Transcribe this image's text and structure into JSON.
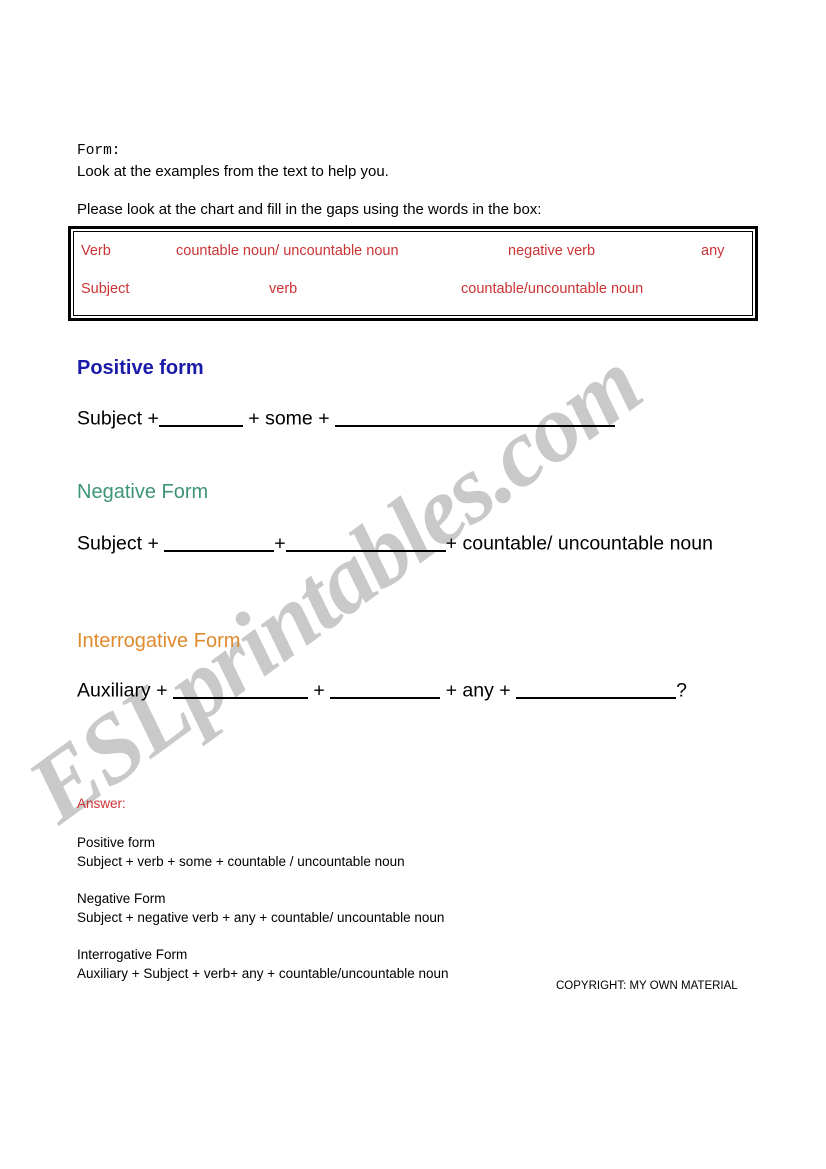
{
  "watermark": {
    "text": "ESLprintables.com",
    "color": "#c9c9c9"
  },
  "header": {
    "form_label": "Form:",
    "instruction_1": "Look at the examples from the text  to help you.",
    "instruction_2": "Please look at the chart and fill in the gaps using the words in the box:"
  },
  "word_box": {
    "color": "#cc3333",
    "row1": [
      "Verb",
      "countable noun/ uncountable noun",
      "negative verb",
      "any"
    ],
    "row2": [
      "Subject",
      "verb",
      "countable/uncountable noun"
    ]
  },
  "sections": {
    "positive": {
      "heading": "Positive form",
      "color": "#1a1aa8",
      "prefix": "Subject +",
      "middle": "+ some +"
    },
    "negative": {
      "heading": "Negative Form",
      "color": "#3e9478",
      "prefix": "Subject +",
      "plus": "+",
      "suffix": "+ countable/ uncountable",
      "wrap": "noun"
    },
    "interrogative": {
      "heading": "Interrogative Form",
      "color": "#e08a2e",
      "prefix": "Auxiliary +",
      "plus": "+",
      "middle": "+ any +",
      "question_mark": "?"
    }
  },
  "answers": {
    "label": "Answer:",
    "label_color": "#cc3333",
    "items": [
      {
        "title": "Positive form",
        "formula": "Subject + verb + some + countable / uncountable noun"
      },
      {
        "title": "Negative Form",
        "formula": "Subject + negative verb + any + countable/ uncountable noun"
      },
      {
        "title": "Interrogative Form",
        "formula": "Auxiliary + Subject + verb+ any + countable/uncountable noun"
      }
    ]
  },
  "copyright": "COPYRIGHT: MY OWN MATERIAL"
}
